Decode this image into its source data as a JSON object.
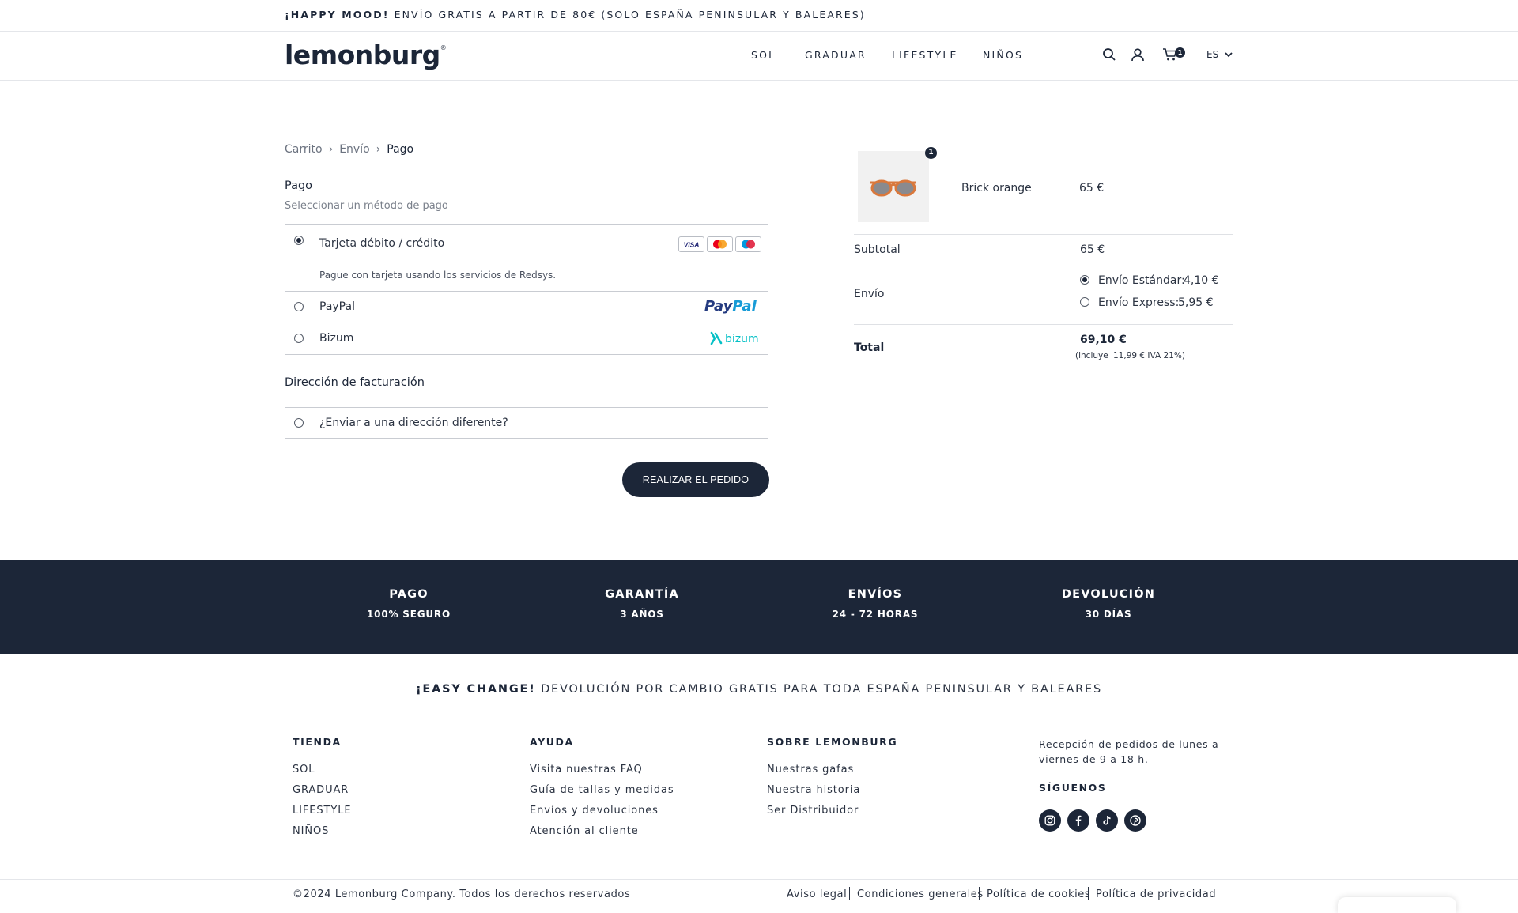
{
  "announcement": {
    "bold": "¡HAPPY MOOD!",
    "text": "ENVÍO GRATIS A PARTIR DE 80€ (SOLO ESPAÑA PENINSULAR Y BALEARES)"
  },
  "header": {
    "logo": "lemonburg",
    "logo_mark": "®",
    "nav": [
      "SOL",
      "GRADUAR",
      "LIFESTYLE",
      "NIÑOS"
    ],
    "cart_count": "1",
    "language": "ES",
    "icons": [
      "search-icon",
      "user-icon",
      "cart-icon",
      "chevron-down-icon"
    ]
  },
  "breadcrumb": {
    "items": [
      "Carrito",
      "Envío",
      "Pago"
    ],
    "separator": "›"
  },
  "payment": {
    "title": "Pago",
    "subtitle": "Seleccionar un método de pago",
    "methods": [
      {
        "label": "Tarjeta débito / crédito",
        "description": "Pague con tarjeta usando los servicios de Redsys.",
        "selected": true,
        "cards": [
          "VISA",
          "mastercard",
          "maestro"
        ]
      },
      {
        "label": "PayPal",
        "logo": "PayPal",
        "selected": false
      },
      {
        "label": "Bizum",
        "logo": "bizum",
        "selected": false
      }
    ]
  },
  "billing": {
    "title": "Dirección de facturación",
    "option": "¿Enviar a una dirección diferente?"
  },
  "place_order": "REALIZAR EL PEDIDO",
  "summary": {
    "product": {
      "qty": "1",
      "name": "Brick orange",
      "price": "65 €"
    },
    "subtotal_label": "Subtotal",
    "subtotal": "65 €",
    "shipping_label": "Envío",
    "shipping_options": [
      {
        "label": "Envío Estándar:",
        "price": "4,10 €",
        "selected": true
      },
      {
        "label": "Envío Express:",
        "price": "5,95 €",
        "selected": false
      }
    ],
    "total_label": "Total",
    "total": "69,10 €",
    "tax_note_a": "(incluye",
    "tax_note_b": "11,99 € IVA 21%)"
  },
  "features": [
    {
      "title": "PAGO",
      "subtitle": "100% SEGURO"
    },
    {
      "title": "GARANTÍA",
      "subtitle": "3 AÑOS"
    },
    {
      "title": "ENVÍOS",
      "subtitle": "24 - 72 HORAS"
    },
    {
      "title": "DEVOLUCIÓN",
      "subtitle": "30 DÍAS"
    }
  ],
  "easy_change": {
    "bold": "¡EASY CHANGE!",
    "text": "DEVOLUCIÓN POR CAMBIO GRATIS PARA TODA ESPAÑA PENINSULAR Y BALEARES"
  },
  "footer": {
    "tienda": {
      "title": "TIENDA",
      "links": [
        "SOL",
        "GRADUAR",
        "LIFESTYLE",
        "NIÑOS"
      ]
    },
    "ayuda": {
      "title": "AYUDA",
      "links": [
        "Visita nuestras FAQ",
        "Guía de tallas y medidas",
        "Envíos y devoluciones",
        "Atención al cliente"
      ]
    },
    "sobre": {
      "title": "SOBRE LEMONBURG",
      "links": [
        "Nuestras gafas",
        "Nuestra historia",
        "Ser Distribuidor"
      ]
    },
    "hours_line1": "Recepción de pedidos de lunes a",
    "hours_line2": "viernes de 9 a 18 h.",
    "follow_title": "SÍGUENOS",
    "social": [
      "instagram-icon",
      "facebook-icon",
      "tiktok-icon",
      "pinterest-icon"
    ],
    "copyright": "©2024 Lemonburg Company. Todos los derechos reservados",
    "legal": [
      "Aviso legal",
      "Condiciones generales",
      "Política de cookies",
      "Política de privacidad"
    ]
  },
  "colors": {
    "navy": "#1c2638",
    "border": "#c9ccd2",
    "paypal_blue": "#253b80",
    "paypal_light": "#179bd7",
    "bizum_teal": "#05c0c6",
    "frame_orange": "#d9783c"
  }
}
